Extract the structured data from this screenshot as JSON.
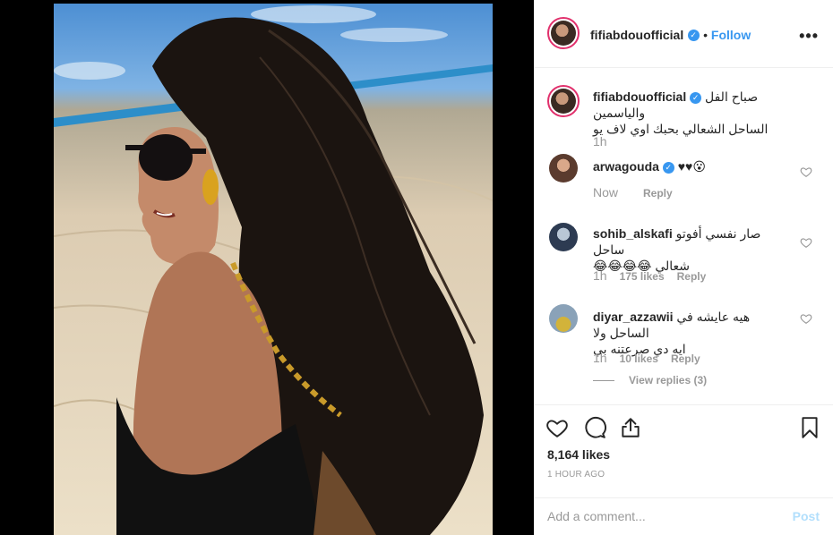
{
  "post": {
    "author": "fifiabdouofficial",
    "follow_label": "Follow",
    "more_label": "•••",
    "caption_line1": "صباح الفل والياسمين",
    "caption_line2": "الساحل الشعالي بحبك اوي لاف يو",
    "caption_time": "1h"
  },
  "comments": [
    {
      "user": "arwagouda",
      "verified": true,
      "text": "♥♥😮",
      "time": "Now",
      "likes": "",
      "reply_label": "Reply"
    },
    {
      "user": "sohib_alskafi",
      "verified": false,
      "text_line1": "صار نفسي أفوتو ساحل",
      "text_line2": "شعالي 😂😂😂😂",
      "time": "1h",
      "likes": "175 likes",
      "reply_label": "Reply"
    },
    {
      "user": "diyar_azzawii",
      "verified": false,
      "text_line1": "هيه عايشه في الساحل ولا",
      "text_line2": "ايه دي صرعتنه بي",
      "time": "1h",
      "likes": "10 likes",
      "reply_label": "Reply",
      "view_replies": "View replies (3)"
    }
  ],
  "stats": {
    "likes": "8,164 likes",
    "time_ago": "1 HOUR AGO"
  },
  "composer": {
    "placeholder": "Add a comment...",
    "post_label": "Post"
  },
  "colors": {
    "accent": "#3897f0",
    "muted": "#999999",
    "ring": "#e1306c"
  }
}
